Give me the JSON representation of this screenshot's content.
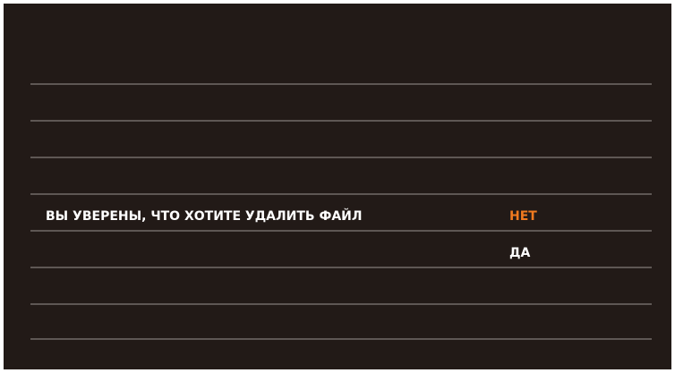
{
  "dialog": {
    "question": "ВЫ УВЕРЕНЫ, ЧТО ХОТИТЕ УДАЛИТЬ ФАЙЛ",
    "options": [
      {
        "label": "НЕТ",
        "selected": true
      },
      {
        "label": "ДА",
        "selected": false
      }
    ]
  },
  "colors": {
    "background": "#221a17",
    "divider": "#5e5754",
    "text": "#ffffff",
    "selected": "#f07a1f"
  }
}
